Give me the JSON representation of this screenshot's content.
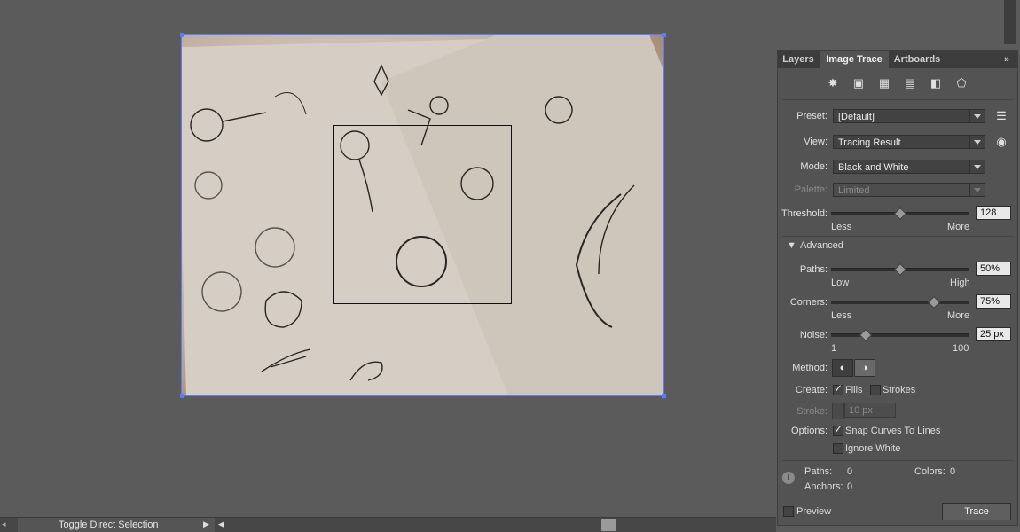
{
  "panel": {
    "tabs": [
      "Layers",
      "Image Trace",
      "Artboards"
    ],
    "active_tab": "Image Trace",
    "preset": {
      "label": "Preset:",
      "value": "[Default]"
    },
    "view": {
      "label": "View:",
      "value": "Tracing Result"
    },
    "mode": {
      "label": "Mode:",
      "value": "Black and White"
    },
    "palette": {
      "label": "Palette:",
      "value": "Limited"
    },
    "threshold": {
      "label": "Threshold:",
      "value": "128",
      "level": 0.5,
      "min_label": "Less",
      "max_label": "More"
    },
    "advanced_label": "Advanced",
    "paths": {
      "label": "Paths:",
      "value": "50%",
      "level": 0.5,
      "min_label": "Low",
      "max_label": "High"
    },
    "corners": {
      "label": "Corners:",
      "value": "75%",
      "level": 0.75,
      "min_label": "Less",
      "max_label": "More"
    },
    "noise": {
      "label": "Noise:",
      "value": "25 px",
      "level": 0.25,
      "min_label": "1",
      "max_label": "100"
    },
    "method_label": "Method:",
    "create": {
      "label": "Create:",
      "fills": "Fills",
      "fills_checked": true,
      "strokes": "Strokes",
      "strokes_checked": false
    },
    "stroke": {
      "label": "Stroke:",
      "value": "10 px"
    },
    "options": {
      "label": "Options:",
      "snap": "Snap Curves To Lines",
      "snap_checked": true,
      "ignore": "Ignore White",
      "ignore_checked": false
    },
    "stats": {
      "paths_label": "Paths:",
      "paths": "0",
      "colors_label": "Colors:",
      "colors": "0",
      "anchors_label": "Anchors:",
      "anchors": "0"
    },
    "preview_label": "Preview",
    "trace_button": "Trace"
  },
  "statusbar": {
    "tool_label": "Toggle Direct Selection"
  },
  "colors": {
    "accent": "#5a7cff",
    "panel_bg": "#535353",
    "canvas_bg": "#5b5b5b"
  }
}
